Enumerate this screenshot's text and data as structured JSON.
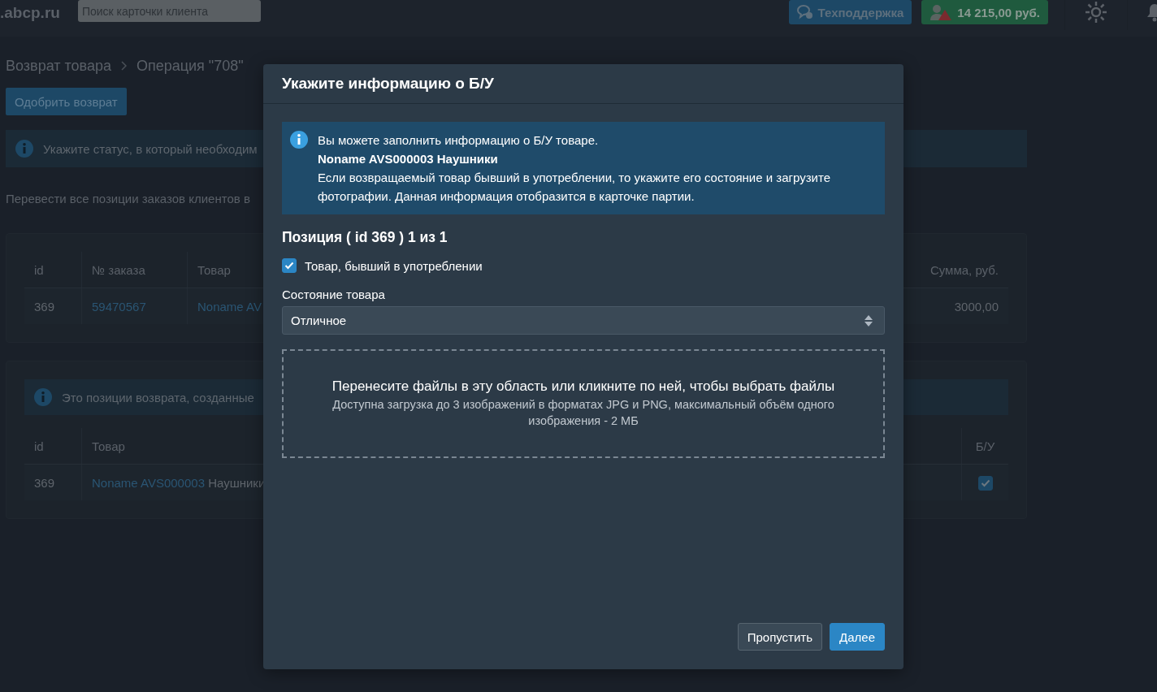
{
  "topbar": {
    "logo": ".abcp.ru",
    "search": {
      "placeholder": "Поиск карточки клиента"
    },
    "support_button": "Техподдержка",
    "balance": "14 215,00 руб."
  },
  "breadcrumbs": [
    "Возврат товара",
    "Операция \"708\""
  ],
  "approve_button": "Одобрить возврат",
  "status_alert": "Укажите статус, в который необходим",
  "transfer_text": "Перевести все позиции заказов клиентов в",
  "orders_table": {
    "columns": [
      "id",
      "№ заказа",
      "Товар",
      "Сумма, руб."
    ],
    "rows": [
      {
        "id": "369",
        "order": "59470567",
        "product": "Noname AV",
        "sum": "3000,00"
      }
    ]
  },
  "returns_alert": "Это позиции возврата, созданные",
  "returns_table": {
    "columns": [
      "id",
      "Товар",
      "Б/У"
    ],
    "rows": [
      {
        "id": "369",
        "product_link": "Noname AVS000003",
        "product_name": "Наушники",
        "used": true
      }
    ]
  },
  "modal": {
    "title": "Укажите информацию о Б/У",
    "info": {
      "intro": "Вы можете заполнить информацию о Б/У товаре.",
      "product": "Noname AVS000003 Наушники",
      "description": "Если возвращаемый товар бывший в употреблении, то укажите его состояние и загрузите фотографии. Данная информация отобразится в карточке партии."
    },
    "position": "Позиция ( id 369 ) 1 из 1",
    "used_checkbox": {
      "label": "Товар, бывший в употреблении",
      "checked": true
    },
    "condition": {
      "label": "Состояние товара",
      "value": "Отличное"
    },
    "dropzone": {
      "title": "Перенесите файлы в эту область или кликните по ней, чтобы выбрать файлы",
      "hint": "Доступна загрузка до 3 изображений в форматах JPG и PNG, максимальный объём одного изображения - 2 МБ"
    },
    "buttons": [
      {
        "label": "Пропустить",
        "kind": "secondary"
      },
      {
        "label": "Далее",
        "kind": "primary"
      }
    ]
  }
}
